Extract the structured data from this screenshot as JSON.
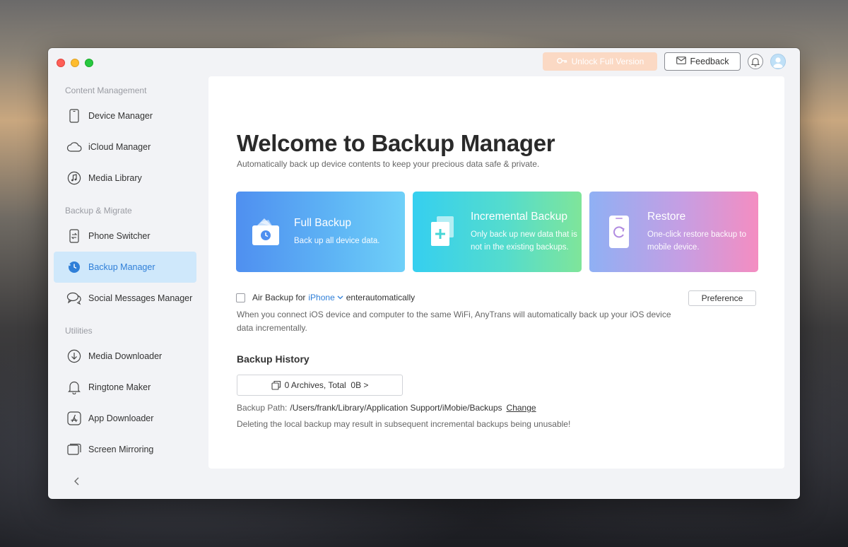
{
  "topbar": {
    "unlock_label": "Unlock Full Version",
    "feedback_label": "Feedback"
  },
  "sidebar": {
    "sections": [
      {
        "title": "Content Management",
        "items": [
          {
            "label": "Device Manager",
            "icon": "phone-icon"
          },
          {
            "label": "iCloud Manager",
            "icon": "cloud-icon"
          },
          {
            "label": "Media Library",
            "icon": "music-note-icon"
          }
        ]
      },
      {
        "title": "Backup & Migrate",
        "items": [
          {
            "label": "Phone Switcher",
            "icon": "phone-switch-icon"
          },
          {
            "label": "Backup Manager",
            "icon": "backup-clock-icon",
            "active": true
          },
          {
            "label": "Social Messages Manager",
            "icon": "chat-bubbles-icon"
          }
        ]
      },
      {
        "title": "Utilities",
        "items": [
          {
            "label": "Media Downloader",
            "icon": "download-icon"
          },
          {
            "label": "Ringtone Maker",
            "icon": "bell-icon"
          },
          {
            "label": "App Downloader",
            "icon": "app-store-icon"
          },
          {
            "label": "Screen Mirroring",
            "icon": "screen-mirror-icon"
          }
        ]
      }
    ]
  },
  "main": {
    "title": "Welcome to Backup Manager",
    "subtitle": "Automatically back up device contents to keep your precious data safe & private.",
    "cards": [
      {
        "title": "Full Backup",
        "desc": "Back up all device data."
      },
      {
        "title": "Incremental Backup",
        "desc_line1": "Only back up new data that is",
        "desc_line2": "not in the existing backups."
      },
      {
        "title": "Restore",
        "desc_line1": "One-click restore backup to",
        "desc_line2": "mobile device."
      }
    ],
    "air_backup": {
      "prefix": "Air Backup for",
      "device": "iPhone",
      "suffix": "enterautomatically",
      "preference_label": "Preference",
      "description": "When you connect iOS device and computer to the same WiFi, AnyTrans will automatically back up your iOS device data incrementally."
    },
    "history": {
      "title": "Backup History",
      "archives_label": "0 Archives, Total  0B >",
      "path_label": "Backup Path:",
      "path_value": "/Users/frank/Library/Application Support/iMobie/Backups",
      "change_label": "Change",
      "warning": "Deleting the local backup may result in subsequent incremental backups being unusable!"
    }
  },
  "colors": {
    "accent": "#2f7fd8",
    "active_bg": "#cfe8fb",
    "unlock_bg": "#fbd9c4"
  }
}
